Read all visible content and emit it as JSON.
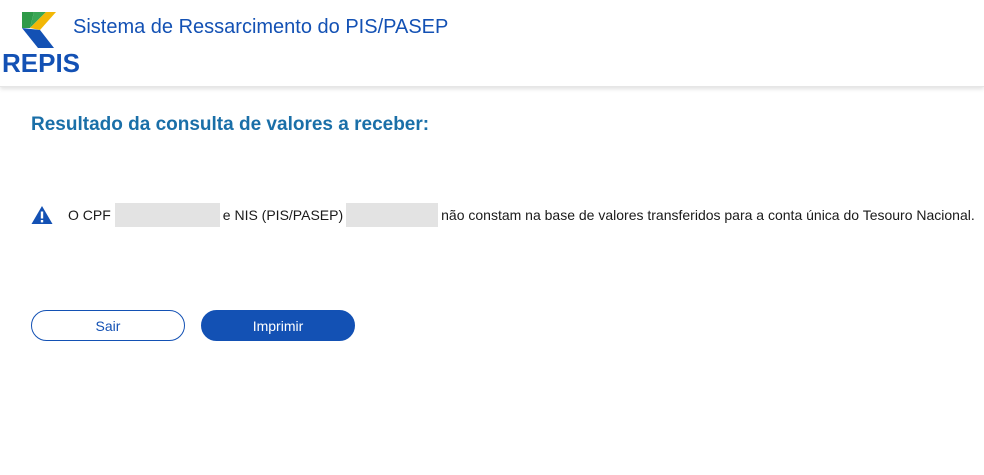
{
  "header": {
    "logo_text": "REPIS",
    "system_title": "Sistema de Ressarcimento do PIS/PASEP"
  },
  "main": {
    "heading": "Resultado da consulta de valores a receber:",
    "alert": {
      "icon": "warning-triangle-icon",
      "text_prefix": "O CPF",
      "text_middle": "e NIS (PIS/PASEP)",
      "text_suffix": "não constam na base de valores transferidos para a conta única do Tesouro Nacional."
    },
    "buttons": {
      "exit_label": "Sair",
      "print_label": "Imprimir"
    }
  },
  "colors": {
    "brand_blue": "#1351b4",
    "heading_blue": "#1a6fa8",
    "logo_green": "#2e9a48",
    "logo_yellow": "#f2b705",
    "redaction_gray": "#e3e3e3"
  }
}
